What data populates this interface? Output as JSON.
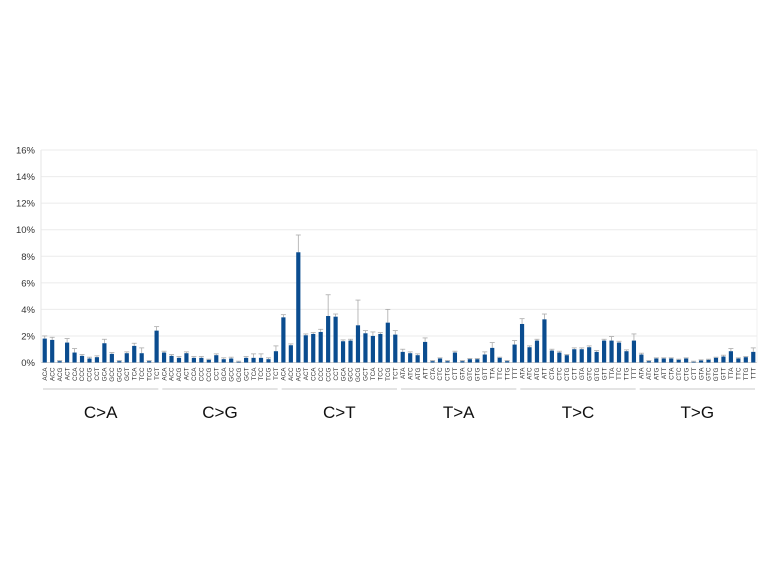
{
  "chart_data": {
    "type": "bar",
    "ylim": [
      0,
      16
    ],
    "yticks": [
      "0%",
      "2%",
      "4%",
      "6%",
      "8%",
      "10%",
      "12%",
      "14%",
      "16%"
    ],
    "grid": true,
    "bar_color": "#0a4c8f",
    "error_bar_color": "#aaaaaa",
    "groups": [
      {
        "name": "C>A",
        "categories": [
          "ACA",
          "ACC",
          "ACG",
          "ACT",
          "CCA",
          "CCC",
          "CCG",
          "CCT",
          "GCA",
          "GCC",
          "GCG",
          "GCT",
          "TCA",
          "TCC",
          "TCG",
          "TCT"
        ],
        "values": [
          1.8,
          1.7,
          0.1,
          1.5,
          0.75,
          0.5,
          0.3,
          0.4,
          1.45,
          0.65,
          0.1,
          0.7,
          1.25,
          0.7,
          0.1,
          2.4
        ],
        "errors": [
          0.2,
          0.2,
          0.05,
          0.3,
          0.3,
          0.1,
          0.1,
          0.1,
          0.3,
          0.1,
          0.05,
          0.1,
          0.2,
          0.4,
          0.05,
          0.3
        ]
      },
      {
        "name": "C>G",
        "categories": [
          "ACA",
          "ACC",
          "ACG",
          "ACT",
          "CCA",
          "CCC",
          "CCG",
          "CCT",
          "GCA",
          "GCC",
          "GCG",
          "GCT",
          "TCA",
          "TCC",
          "TCG",
          "TCT"
        ],
        "values": [
          0.75,
          0.5,
          0.35,
          0.7,
          0.35,
          0.35,
          0.2,
          0.55,
          0.25,
          0.3,
          0.05,
          0.35,
          0.35,
          0.35,
          0.25,
          0.85
        ],
        "errors": [
          0.1,
          0.1,
          0.1,
          0.1,
          0.1,
          0.1,
          0.05,
          0.1,
          0.1,
          0.1,
          0.05,
          0.1,
          0.3,
          0.3,
          0.1,
          0.4
        ]
      },
      {
        "name": "C>T",
        "categories": [
          "ACA",
          "ACC",
          "ACG",
          "ACT",
          "CCA",
          "CCC",
          "CCG",
          "CCT",
          "GCA",
          "GCC",
          "GCG",
          "GCT",
          "TCA",
          "TCC",
          "TCG",
          "TCT"
        ],
        "values": [
          3.4,
          1.3,
          8.3,
          2.05,
          2.15,
          2.3,
          3.5,
          3.45,
          1.6,
          1.65,
          2.8,
          2.2,
          2.0,
          2.15,
          3.0,
          2.1
        ],
        "errors": [
          0.2,
          0.1,
          1.3,
          0.1,
          0.1,
          0.2,
          1.6,
          0.2,
          0.1,
          0.1,
          1.9,
          0.2,
          0.3,
          0.1,
          1.0,
          0.3
        ]
      },
      {
        "name": "T>A",
        "categories": [
          "ATA",
          "ATC",
          "ATG",
          "ATT",
          "CTA",
          "CTC",
          "CTG",
          "CTT",
          "GTA",
          "GTC",
          "GTG",
          "GTT",
          "TTA",
          "TTC",
          "TTG",
          "TTT"
        ],
        "values": [
          0.8,
          0.7,
          0.55,
          1.55,
          0.1,
          0.3,
          0.1,
          0.75,
          0.1,
          0.25,
          0.25,
          0.6,
          1.1,
          0.35,
          0.1,
          1.35
        ],
        "errors": [
          0.2,
          0.1,
          0.1,
          0.3,
          0.05,
          0.05,
          0.05,
          0.1,
          0.05,
          0.05,
          0.05,
          0.2,
          0.4,
          0.05,
          0.05,
          0.3
        ]
      },
      {
        "name": "T>C",
        "categories": [
          "ATA",
          "ATC",
          "ATG",
          "ATT",
          "CTA",
          "CTC",
          "CTG",
          "CTT",
          "GTA",
          "GTC",
          "GTG",
          "GTT",
          "TTA",
          "TTC",
          "TTG",
          "TTT"
        ],
        "values": [
          2.9,
          1.15,
          1.65,
          3.25,
          0.9,
          0.75,
          0.55,
          1.0,
          1.0,
          1.15,
          0.8,
          1.65,
          1.65,
          1.5,
          0.85,
          1.65
        ],
        "errors": [
          0.4,
          0.1,
          0.1,
          0.4,
          0.1,
          0.1,
          0.05,
          0.1,
          0.1,
          0.1,
          0.1,
          0.1,
          0.3,
          0.1,
          0.1,
          0.5
        ]
      },
      {
        "name": "T>G",
        "categories": [
          "ATA",
          "ATC",
          "ATG",
          "ATT",
          "CTA",
          "CTC",
          "CTG",
          "CTT",
          "GTA",
          "GTC",
          "GTG",
          "GTT",
          "TTA",
          "TTC",
          "TTG",
          "TTT"
        ],
        "values": [
          0.6,
          0.1,
          0.3,
          0.3,
          0.3,
          0.2,
          0.3,
          0.05,
          0.15,
          0.2,
          0.35,
          0.45,
          0.85,
          0.3,
          0.4,
          0.8
        ],
        "errors": [
          0.1,
          0.05,
          0.05,
          0.05,
          0.05,
          0.05,
          0.05,
          0.05,
          0.05,
          0.05,
          0.05,
          0.1,
          0.2,
          0.05,
          0.05,
          0.3
        ]
      }
    ]
  }
}
